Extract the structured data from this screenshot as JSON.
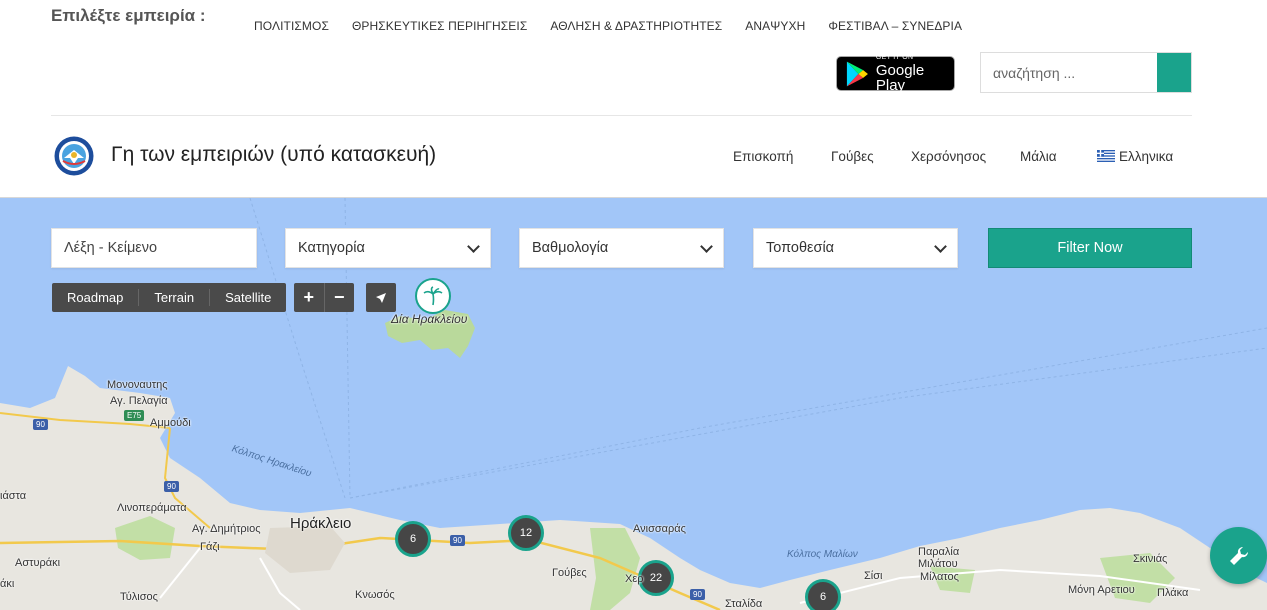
{
  "top": {
    "choose_label": "Επιλέξτε εμπειρία :",
    "categories": [
      "ΠΟΛΙΤΙΣΜΟΣ",
      "ΘΡΗΣΚΕΥΤΙΚΕΣ ΠΕΡΙΗΓΗΣΕΙΣ",
      "ΑΘΛΗΣΗ & ΔΡΑΣΤΗΡΙΟΤΗΤΕΣ",
      "ΑΝΑΨΥΧΗ",
      "ΦΕΣΤΙΒΑΛ – ΣΥΝΕΔΡΙΑ"
    ],
    "google_play": {
      "small": "GET IT ON",
      "big": "Google Play"
    },
    "search_placeholder": "αναζήτηση ..."
  },
  "header": {
    "title": "Γη των εμπειριών (υπό κατασκευή)",
    "nav": [
      "Επισκοπή",
      "Γούβες",
      "Χερσόνησος",
      "Μάλια"
    ],
    "language": "Ελληνικα"
  },
  "filters": {
    "keyword_placeholder": "Λέξη - Κείμενο",
    "category": "Κατηγορία",
    "rating": "Βαθμολογία",
    "location": "Τοποθεσία",
    "submit": "Filter Now"
  },
  "map": {
    "types": [
      "Roadmap",
      "Terrain",
      "Satellite"
    ],
    "zoom_in": "+",
    "zoom_out": "−",
    "island_label": "Δία Ηρακλείου",
    "clusters": [
      "6",
      "12",
      "22",
      "6"
    ],
    "labels": {
      "monovaftis": "Μονοναυτης",
      "agpelagia": "Αγ. Πελαγία",
      "ammoudi": "Αμμούδι",
      "kolpos_irakleiou": "Κόλπος Ηρακλείου",
      "diata": "ιάστα",
      "linoperamata": "Λινοπεράματα",
      "agdimitrios": "Αγ. Δημήτριος",
      "gazi": "Γάζι",
      "astyraki": "Αστυράκι",
      "tylisos": "Τύλισος",
      "raki": "άκι",
      "irakleio": "Ηράκλειο",
      "knosos": "Κνωσός",
      "anissaras": "Ανισσαράς",
      "gouves": "Γούβες",
      "xer": "Χερ",
      "kolpos_malion": "Κόλπος Μαλίων",
      "sisi": "Σίσι",
      "paralia": "Παραλία",
      "milatou": "Μιλάτου",
      "milatos": "Μίλατος",
      "stalida": "Σταλίδα",
      "skinias": "Σκινιάς",
      "moni": "Μόνη Αρετιου",
      "plaka": "Πλάκα"
    },
    "roads": [
      "90",
      "E75",
      "90",
      "90",
      "90"
    ]
  },
  "colors": {
    "accent": "#1aa38c",
    "water": "#a2c6f8",
    "land": "#e8e6e0"
  }
}
